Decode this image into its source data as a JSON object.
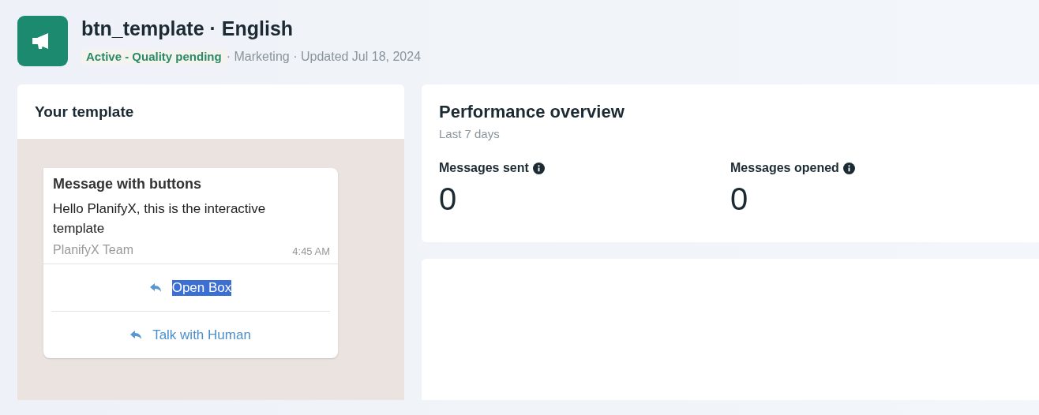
{
  "header": {
    "title": "btn_template · English",
    "status": "Active - Quality pending",
    "meta": " · Marketing · Updated Jul 18, 2024"
  },
  "template_card": {
    "title": "Your template",
    "message": {
      "heading": "Message with buttons",
      "body": "Hello PlanifyX, this is the interactive template",
      "footer": "PlanifyX Team",
      "time": "4:45 AM",
      "buttons": [
        {
          "label": "Open Box",
          "text_selected": true
        },
        {
          "label": "Talk with Human",
          "text_selected": false
        }
      ]
    }
  },
  "performance": {
    "title": "Performance overview",
    "period": "Last 7 days",
    "metrics": [
      {
        "label": "Messages sent",
        "value": "0"
      },
      {
        "label": "Messages opened",
        "value": "0"
      }
    ]
  }
}
